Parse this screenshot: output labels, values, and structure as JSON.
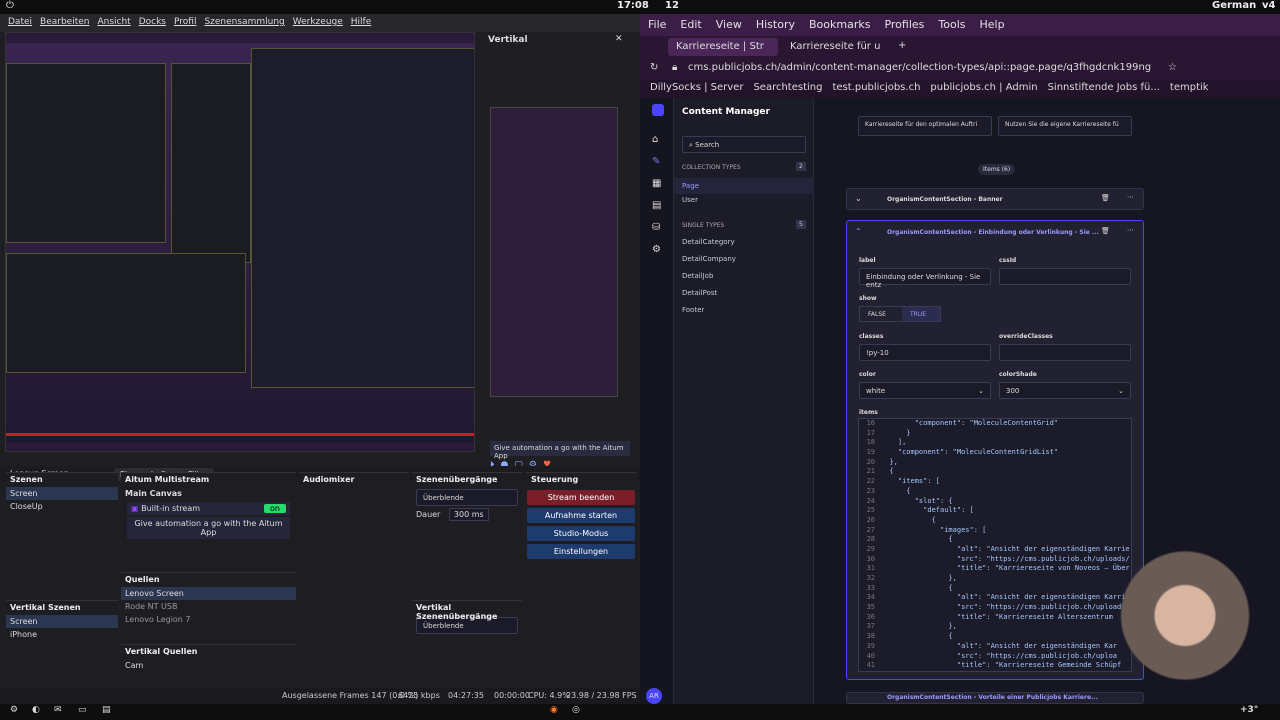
{
  "topbar": {
    "clock": "17:08",
    "workspace": "12",
    "language": "German",
    "volume": "v4"
  },
  "obs": {
    "menu": [
      "Datei",
      "Bearbeiten",
      "Ansicht",
      "Docks",
      "Profil",
      "Szenensammlung",
      "Werkzeuge",
      "Hilfe"
    ],
    "vertical_title": "Vertikal",
    "aitum_banner": "Give automation a go with the Aitum App",
    "source_bar": {
      "source": "Lenovo Screen",
      "properties": "Eigenschaften",
      "filter": "Filter"
    },
    "scenes": {
      "title": "Szenen",
      "items": [
        "Screen",
        "CloseUp"
      ]
    },
    "vertical_scenes": {
      "title": "Vertikal Szenen",
      "items": [
        "Screen",
        "iPhone"
      ]
    },
    "aitum": {
      "title": "Aitum Multistream",
      "main_canvas": "Main Canvas",
      "builtin": "Built-in stream",
      "banner": "Give automation a go with the Aitum App"
    },
    "sources": {
      "title": "Quellen",
      "items": [
        "Lenovo Screen",
        "Rode NT USB",
        "Lenovo Legion 7"
      ]
    },
    "vertical_sources": {
      "title": "Vertikal Quellen",
      "items": [
        "Cam"
      ]
    },
    "mixer": {
      "title": "Audiomixer"
    },
    "transitions": {
      "title": "Szenenübergänge",
      "value": "Überblende",
      "duration_label": "Dauer",
      "duration": "300 ms"
    },
    "vertical_transitions": {
      "title": "Vertikal Szenenübergänge",
      "value": "Überblende"
    },
    "controls": {
      "title": "Steuerung",
      "buttons": [
        "Stream beenden",
        "Aufnahme starten",
        "Studio-Modus",
        "Einstellungen"
      ]
    },
    "status": {
      "dropped": "Ausgelassene Frames 147 (0.0 %)",
      "bitrate": "6425 kbps",
      "time1": "04:27:35",
      "time2": "00:00:00",
      "cpu": "CPU: 4.9%",
      "fps": "23.98 / 23.98 FPS"
    }
  },
  "browser": {
    "menu": [
      "File",
      "Edit",
      "View",
      "History",
      "Bookmarks",
      "Profiles",
      "Tools",
      "Help"
    ],
    "tabs": [
      "Karriereseite | Str",
      "Karriereseite für u"
    ],
    "url": "cms.publicjobs.ch/admin/content-manager/collection-types/api::page.page/q3fhgdcnk199ng",
    "bookmarks": [
      "DillySocks | Server",
      "Searchtesting",
      "test.publicjobs.ch",
      "publicjobs.ch | Admin",
      "Sinnstiftende Jobs fü...",
      "temptik"
    ]
  },
  "cms": {
    "title": "Content Manager",
    "search": "Search",
    "collection_types_label": "COLLECTION TYPES",
    "collection_count": "2",
    "collection_types": [
      "Page",
      "User"
    ],
    "single_types_label": "SINGLE TYPES",
    "single_count": "5",
    "single_types": [
      "DetailCategory",
      "DetailCompany",
      "DetailJob",
      "DetailPost",
      "Footer"
    ],
    "top_buttons": [
      "Karriereseite für den optimalen Auftri",
      "Nutzen Sie die eigene Karriereseite fü"
    ],
    "items_count": "Items (6)",
    "section1": "OrganismContentSection - Banner",
    "section2": "OrganismContentSection - Einbindung oder Verlinkung - Sie ...",
    "label_lbl": "label",
    "label_val": "Einbindung oder Verlinkung - Sie entz",
    "cssid_lbl": "cssId",
    "show_lbl": "show",
    "show_false": "FALSE",
    "show_true": "TRUE",
    "classes_lbl": "classes",
    "classes_val": "!py-10",
    "override_lbl": "overrideClasses",
    "color_lbl": "color",
    "color_val": "white",
    "shade_lbl": "colorShade",
    "shade_val": "300",
    "items_lbl": "items",
    "section3": "OrganismContentSection - Vorteile einer Publicjobs Karriere...",
    "avatar": "AR",
    "code": [
      [
        "16",
        "        \"component\": \"MoleculeContentGrid\""
      ],
      [
        "17",
        "      }"
      ],
      [
        "18",
        "    ],"
      ],
      [
        "19",
        "    \"component\": \"MoleculeContentGridList\""
      ],
      [
        "20",
        "  },"
      ],
      [
        "21",
        "  {"
      ],
      [
        "22",
        "    \"items\": ["
      ],
      [
        "23",
        "      {"
      ],
      [
        "24",
        "        \"slot\": {"
      ],
      [
        "25",
        "          \"default\": ["
      ],
      [
        "26",
        "            {"
      ],
      [
        "27",
        "              \"images\": ["
      ],
      [
        "28",
        "                {"
      ],
      [
        "29",
        "                  \"alt\": \"Ansicht der eigenständigen Karrie"
      ],
      [
        "30",
        "                  \"src\": \"https://cms.publicjob.ch/uploads/"
      ],
      [
        "31",
        "                  \"title\": \"Karriereseite von Noveos – Über"
      ],
      [
        "32",
        "                },"
      ],
      [
        "33",
        "                {"
      ],
      [
        "34",
        "                  \"alt\": \"Ansicht der eigenständigen Karri"
      ],
      [
        "35",
        "                  \"src\": \"https://cms.publicjob.ch/uploads"
      ],
      [
        "36",
        "                  \"title\": \"Karriereseite Alterszentrum"
      ],
      [
        "37",
        "                },"
      ],
      [
        "38",
        "                {"
      ],
      [
        "39",
        "                  \"alt\": \"Ansicht der eigenständigen Kar"
      ],
      [
        "40",
        "                  \"src\": \"https://cms.publicjob.ch/uploa"
      ],
      [
        "41",
        "                  \"title\": \"Karriereseite Gemeinde Schüpf"
      ]
    ]
  }
}
